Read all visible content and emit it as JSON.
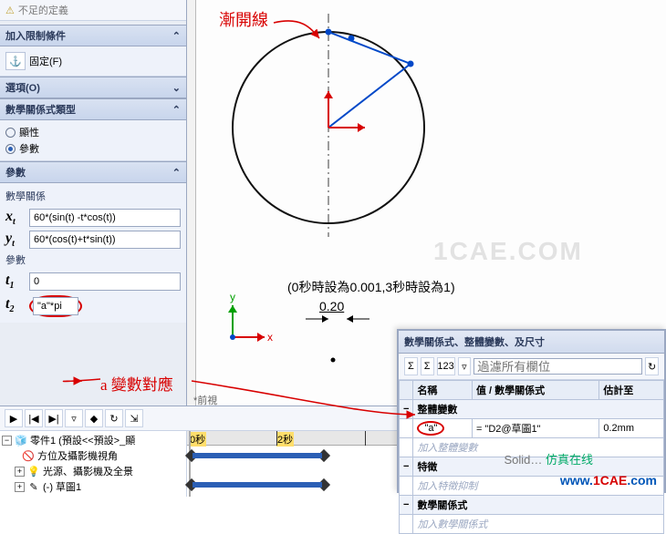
{
  "status": {
    "warn_icon": "⚠",
    "text": "不足的定義"
  },
  "sections": {
    "constraints": {
      "title": "加入限制條件",
      "fix_label": "固定(F)",
      "toggle": "⌃"
    },
    "options": {
      "title": "選項(O)",
      "toggle": "⌄"
    },
    "eqtype": {
      "title": "數學關係式類型",
      "opt_visible": "顯性",
      "opt_param": "參數",
      "toggle": "⌃"
    },
    "params": {
      "title": "參數",
      "group1_label": "數學關係",
      "xt_var": "x",
      "xt_sub": "t",
      "xt_val": "60*(sin(t) -t*cos(t))",
      "yt_var": "y",
      "yt_sub": "t",
      "yt_val": "60*(cos(t)+t*sin(t))",
      "group2_label": "參數",
      "t1_var": "t",
      "t1_sub": "1",
      "t1_val": "0",
      "t2_var": "t",
      "t2_sub": "2",
      "t2_val": "\"a\"*pi",
      "toggle": "⌃"
    }
  },
  "annotations": {
    "involute": "漸開線",
    "a_var_map": "a 變數對應",
    "timing_note": "(0秒時設為0.001,3秒時設為1)",
    "dim_value": "0.20",
    "axis_x": "x",
    "axis_y": "y",
    "view_label": "*前視"
  },
  "timeline": {
    "sec0": "0秒",
    "sec2": "2秒",
    "tree": {
      "root": "零件1 (預設<<預設>_顯",
      "n1": "方位及攝影機視角",
      "n2": "光源、攝影機及全景",
      "n3": "(-) 草圖1"
    }
  },
  "eq_panel": {
    "title": "數學關係式、整體變數、及尺寸",
    "filter_placeholder": "過濾所有欄位",
    "col_name": "名稱",
    "col_value": "值 / 數學關係式",
    "col_eval": "估計至",
    "cat_global": "整體變數",
    "row_a_name": "\"a\"",
    "row_a_val": "= \"D2@草圖1\"",
    "row_a_eval": "0.2mm",
    "hint_global": "加入整體變數",
    "cat_feature": "特徵",
    "hint_feature": "加入特徵抑制",
    "cat_eq": "數學關係式",
    "hint_eq": "加入數學關係式"
  },
  "brand": {
    "solidworks": "Solid",
    "fangzhen": "仿真在线",
    "url": "www.1CAE.com"
  },
  "watermark": "1CAE.COM"
}
